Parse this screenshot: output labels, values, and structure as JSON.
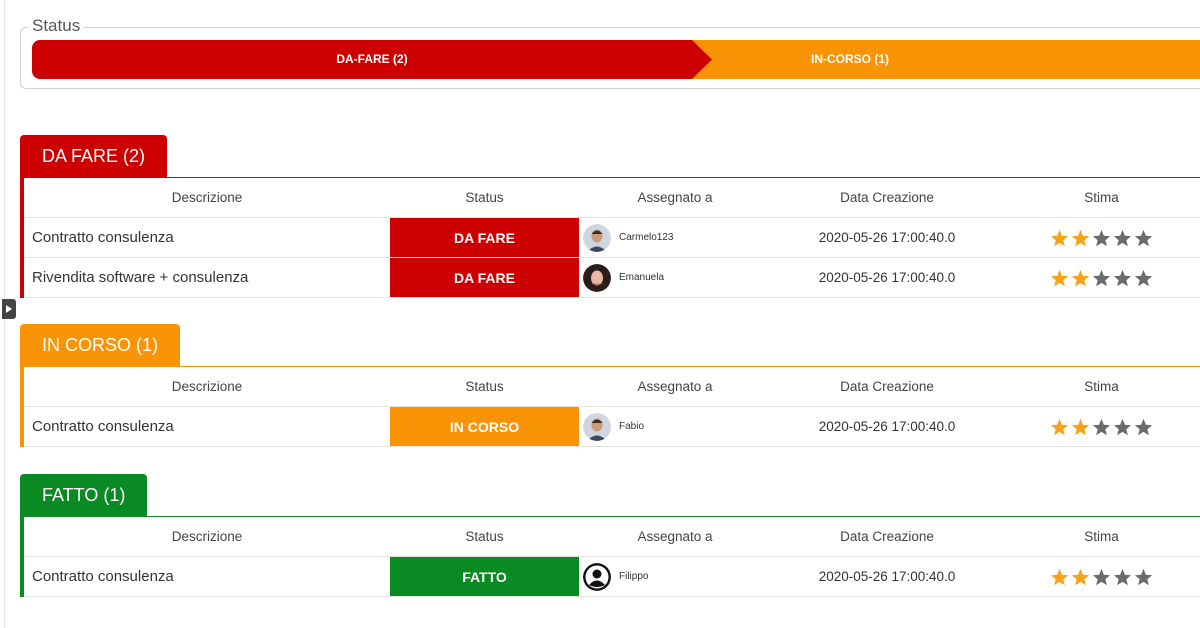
{
  "status_panel": {
    "legend": "Status",
    "segments": [
      {
        "label": "DA-FARE (2)",
        "color": "#cc0000"
      },
      {
        "label": "IN-CORSO (1)",
        "color": "#f89406"
      }
    ]
  },
  "columns": [
    "Descrizione",
    "Status",
    "Assegnato a",
    "Data Creazione",
    "Stima"
  ],
  "sections": [
    {
      "title": "DA FARE (2)",
      "color": "#cc0000",
      "rows": [
        {
          "descrizione": "Contratto consulenza",
          "status": "DA FARE",
          "assegnato": "Carmelo123",
          "avatar": "man-avatar",
          "data": "2020-05-26 17:00:40.0",
          "stima": 2,
          "stima_max": 5
        },
        {
          "descrizione": "Rivendita software + consulenza",
          "status": "DA FARE",
          "assegnato": "Emanuela",
          "avatar": "woman-avatar",
          "data": "2020-05-26 17:00:40.0",
          "stima": 2,
          "stima_max": 5
        }
      ]
    },
    {
      "title": "IN CORSO (1)",
      "color": "#f89406",
      "rows": [
        {
          "descrizione": "Contratto consulenza",
          "status": "IN CORSO",
          "assegnato": "Fabio",
          "avatar": "man-avatar",
          "data": "2020-05-26 17:00:40.0",
          "stima": 2,
          "stima_max": 5
        }
      ]
    },
    {
      "title": "FATTO (1)",
      "color": "#0a8a22",
      "rows": [
        {
          "descrizione": "Contratto consulenza",
          "status": "FATTO",
          "assegnato": "Filippo",
          "avatar": "default-user-avatar",
          "data": "2020-05-26 17:00:40.0",
          "stima": 2,
          "stima_max": 5
        }
      ]
    }
  ],
  "colors": {
    "star_filled": "#f7a21b",
    "star_empty": "#6b6b6b"
  },
  "icons": {
    "collapse_toggle": "chevron-right-icon",
    "rating": "star-icon"
  }
}
